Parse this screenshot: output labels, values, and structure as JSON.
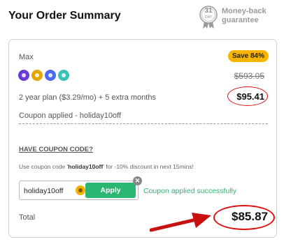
{
  "header": {
    "title": "Your Order Summary",
    "guarantee": {
      "days": "31",
      "day_label": "DAY",
      "text_line1": "Money-back",
      "text_line2": "guarantee"
    }
  },
  "plan": {
    "name": "Max",
    "save_badge": "Save 84%",
    "icons": [
      "vpn-icon",
      "password-manager-icon",
      "cloud-storage-icon",
      "threat-protection-icon"
    ],
    "old_price": "$593.05",
    "description": "2 year plan ($3.29/mo) + 5 extra months",
    "new_price": "$95.41",
    "coupon_applied": "Coupon applied - holiday10off"
  },
  "coupon": {
    "heading": "HAVE COUPON CODE?",
    "hint_prefix": "Use coupon code '",
    "hint_code": "holiday10off",
    "hint_suffix": "' for -10% discount in next 15mins!",
    "input_value": "holiday10off",
    "apply_label": "Apply",
    "clear_label": "✕",
    "success_text": "Coupon applied successfully"
  },
  "total": {
    "label": "Total",
    "price": "$85.87"
  },
  "colors": {
    "accent_green": "#2bb673",
    "badge_yellow": "#f7b500",
    "annotation_red": "#d11111"
  }
}
